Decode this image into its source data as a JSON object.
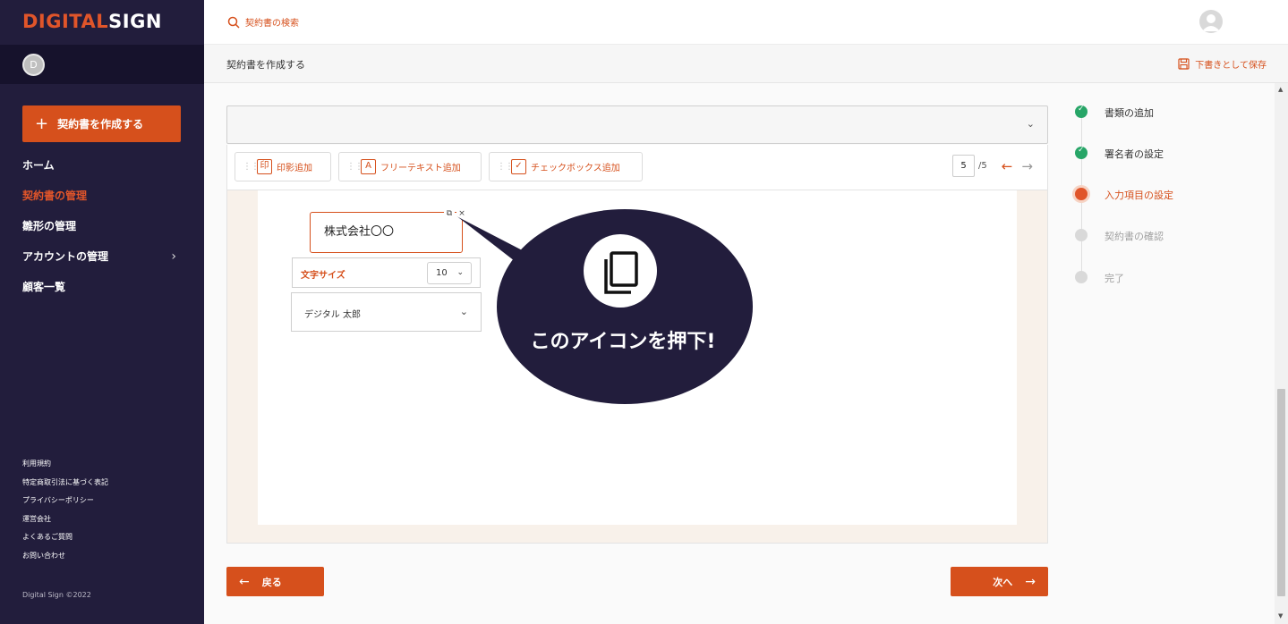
{
  "brand": {
    "logo_part1": "DIGIT",
    "logo_part2": "AL",
    "logo_part3": "SIGN",
    "accent": "#d6501c",
    "sidebar_bg": "#221d3c"
  },
  "user": {
    "initial": "D"
  },
  "sidebar": {
    "create_button": "契約書を作成する",
    "items": [
      {
        "label": "ホーム",
        "active": false
      },
      {
        "label": "契約書の管理",
        "active": true
      },
      {
        "label": "雛形の管理",
        "active": false
      },
      {
        "label": "アカウントの管理",
        "active": false,
        "has_children": true
      },
      {
        "label": "顧客一覧",
        "active": false
      }
    ],
    "footer_links": [
      "利用規約",
      "特定商取引法に基づく表記",
      "プライバシーポリシー",
      "運営会社",
      "よくあるご質問",
      "お問い合わせ"
    ],
    "copyright": "Digital Sign ©2022"
  },
  "topbar": {
    "search_placeholder": "契約書の検索"
  },
  "subheader": {
    "title": "契約書を作成する",
    "save_draft": "下書きとして保存"
  },
  "toolbar": {
    "tools": [
      {
        "icon_text": "印",
        "label": "印影追加",
        "icon": "seal-icon"
      },
      {
        "icon_text": "A",
        "label": "フリーテキスト追加",
        "icon": "text-icon"
      },
      {
        "icon_text": "✓",
        "label": "チェックボックス追加",
        "icon": "checkbox-icon"
      }
    ],
    "current_page": "5",
    "total_pages": "/5"
  },
  "field": {
    "text": "株式会社〇〇",
    "font_size_label": "文字サイズ",
    "font_size_value": "10",
    "signer": "デジタル 太郎"
  },
  "callout": {
    "text": "このアイコンを押下!"
  },
  "steps": [
    {
      "label": "書類の追加",
      "status": "done"
    },
    {
      "label": "署名者の設定",
      "status": "done"
    },
    {
      "label": "入力項目の設定",
      "status": "current"
    },
    {
      "label": "契約書の確認",
      "status": "pending"
    },
    {
      "label": "完了",
      "status": "pending"
    }
  ],
  "buttons": {
    "back": "戻る",
    "next": "次へ"
  }
}
